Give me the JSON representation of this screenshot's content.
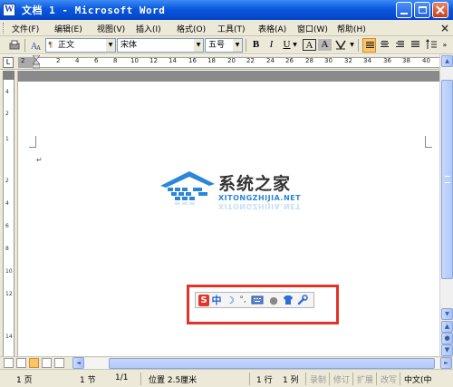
{
  "window": {
    "title": "文档 1 - Microsoft Word",
    "app_icon_letter": "W"
  },
  "menu": {
    "items": [
      "文件(F)",
      "编辑(E)",
      "视图(V)",
      "插入(I)",
      "格式(O)",
      "工具(T)",
      "表格(A)",
      "窗口(W)",
      "帮助(H)"
    ],
    "close_doc": "×"
  },
  "toolbar": {
    "style_value": "正文",
    "font_value": "宋体",
    "size_value": "五号",
    "bold": "B",
    "italic": "I",
    "underline": "U",
    "char_border": "A",
    "char_shading": "A"
  },
  "ruler": {
    "tab_selector": "L",
    "ticks": [
      "2",
      "2",
      "4",
      "6",
      "8",
      "10",
      "12",
      "14",
      "16",
      "18",
      "20",
      "22",
      "24",
      "26",
      "28",
      "30",
      "32",
      "34",
      "36",
      "38",
      "40"
    ],
    "vertical_ticks": [
      "4",
      "2",
      "1",
      "2",
      "4",
      "6",
      "8",
      "10",
      "12",
      "14"
    ]
  },
  "document": {
    "paragraph_mark": "↵"
  },
  "watermark": {
    "brand_cn": "系统之家",
    "brand_en": "XITONGZHIJIA.NET"
  },
  "ime_toolbar": {
    "mode": "中"
  },
  "statusbar": {
    "page": "1 页",
    "section": "1 节",
    "page_of": "1/1",
    "position": "位置 2.5厘米",
    "line": "1 行",
    "column": "1 列",
    "rec": "录制",
    "trk": "修订",
    "ext": "扩展",
    "ovr": "改写",
    "language": "中文(中"
  },
  "colors": {
    "titlebar": "#0a58dd",
    "highlight_box": "#e3342a",
    "logo_blue": "#2a86d8"
  }
}
